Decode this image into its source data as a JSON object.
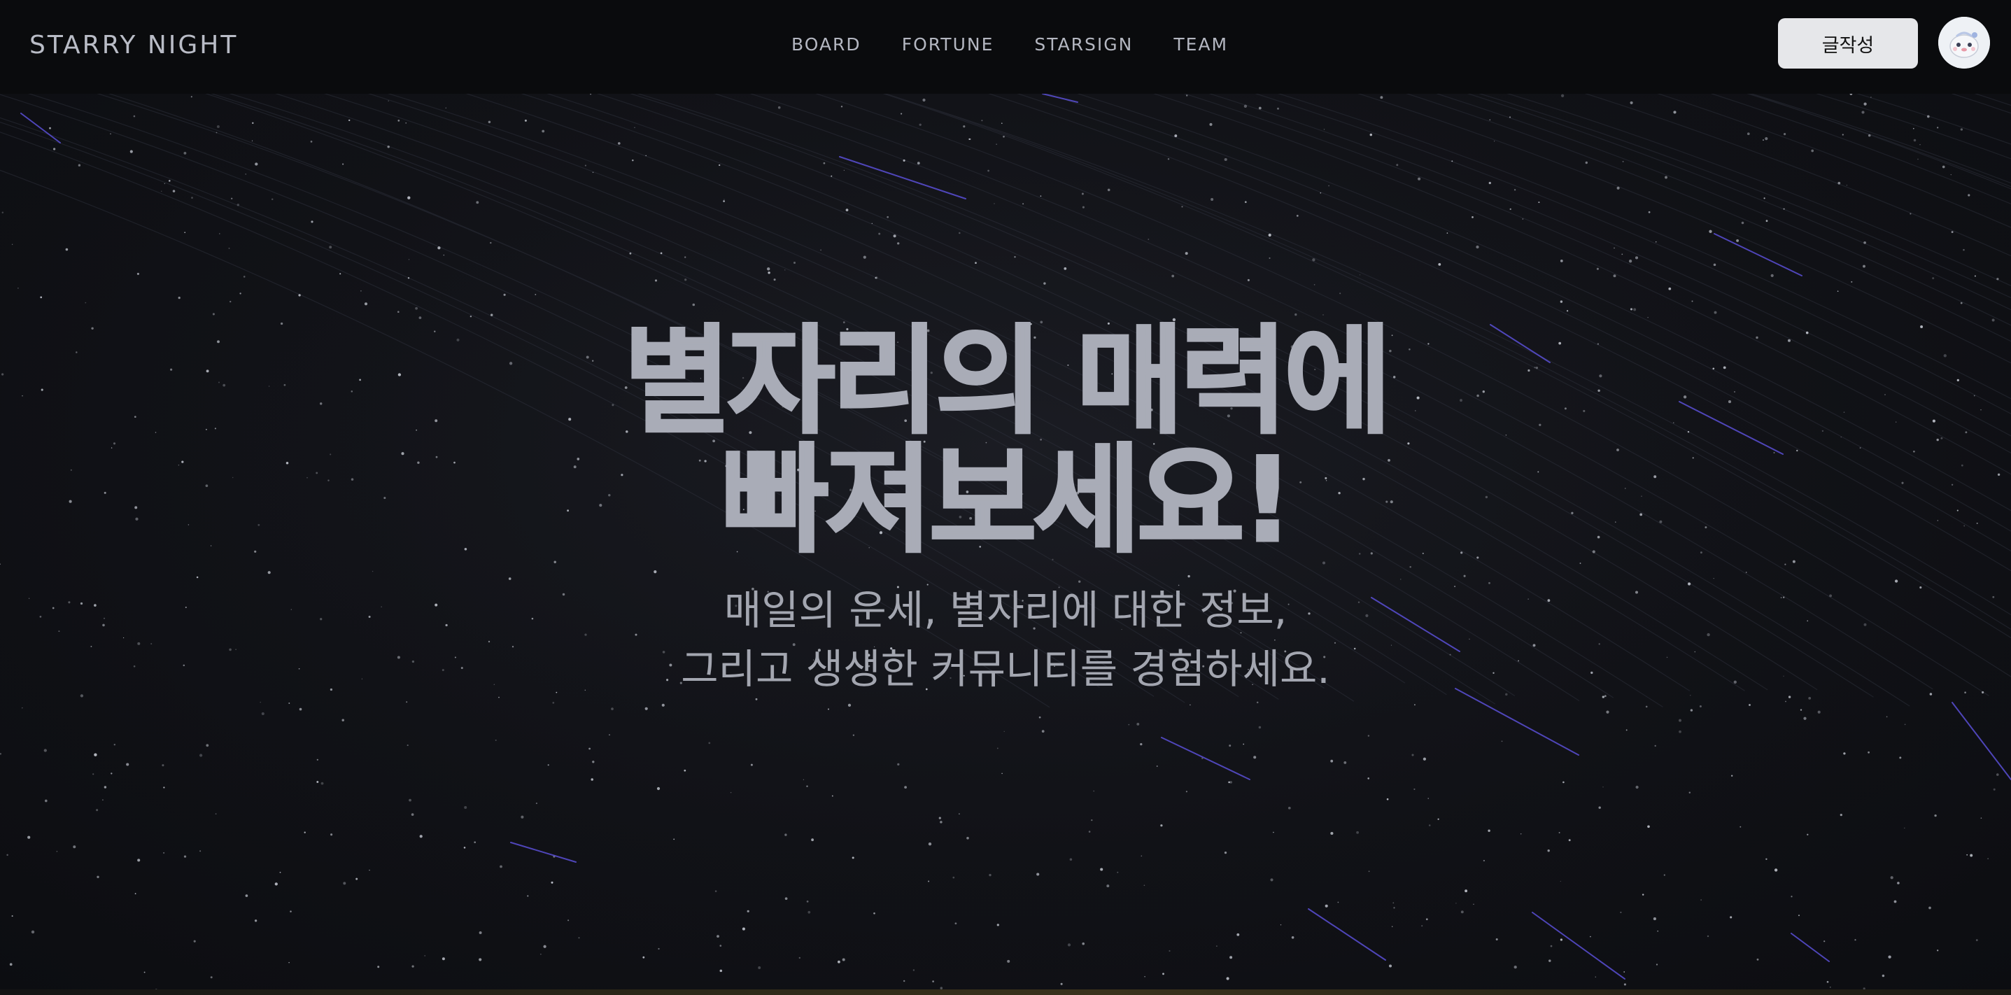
{
  "header": {
    "logo": "STARRY NIGHT",
    "nav": [
      "BOARD",
      "FORTUNE",
      "STARSIGN",
      "TEAM"
    ],
    "write_label": "글작성"
  },
  "hero": {
    "title_line1": "별자리의 매력에",
    "title_line2": "빠져보세요!",
    "subtitle_line1": "매일의 운세, 별자리에 대한 정보,",
    "subtitle_line2": "그리고 생생한 커뮤니티를 경험하세요."
  },
  "colors": {
    "background": "#121318",
    "header": "#0a0b0d",
    "text": "#a9acb7",
    "button": "#e6e7ea",
    "meteor": "#5a4fd6"
  }
}
